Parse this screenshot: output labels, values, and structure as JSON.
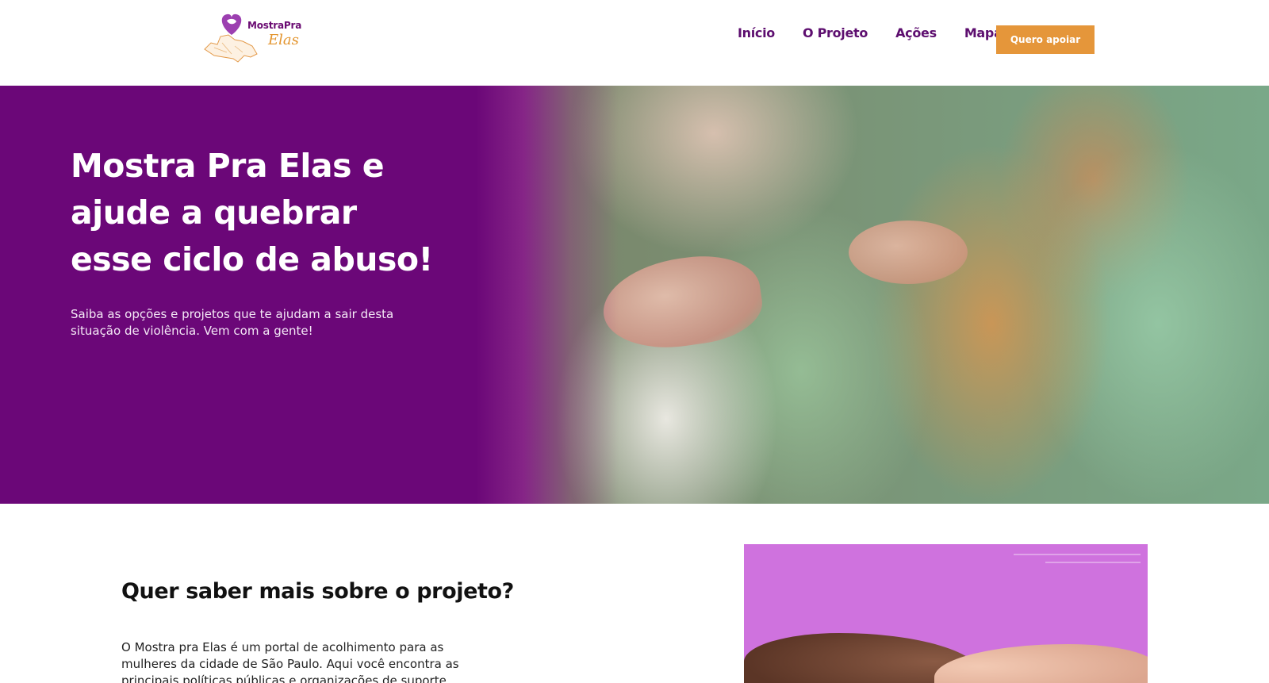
{
  "header": {
    "logo": {
      "line1": "MostraPra",
      "line2": "Elas"
    },
    "nav": [
      {
        "label": "Início"
      },
      {
        "label": "O Projeto"
      },
      {
        "label": "Ações"
      },
      {
        "label": "Mapa"
      }
    ],
    "cta_label": "Quero apoiar"
  },
  "hero": {
    "title": "Mostra Pra Elas e ajude a quebrar esse ciclo de abuso!",
    "subtitle": "Saiba as opções e projetos que te ajudam a sair desta situação de violência. Vem com a gente!"
  },
  "about": {
    "title": "Quer saber mais sobre o projeto?",
    "text": "O Mostra pra Elas é um portal de acolhimento para as mulheres da cidade de São Paulo. Aqui você encontra as principais políticas públicas e organizações de suporte às"
  },
  "colors": {
    "brand_purple": "#6b0778",
    "nav_purple": "#5d0e6f",
    "accent_orange": "#e5963a",
    "image_pink": "#cf72de"
  }
}
